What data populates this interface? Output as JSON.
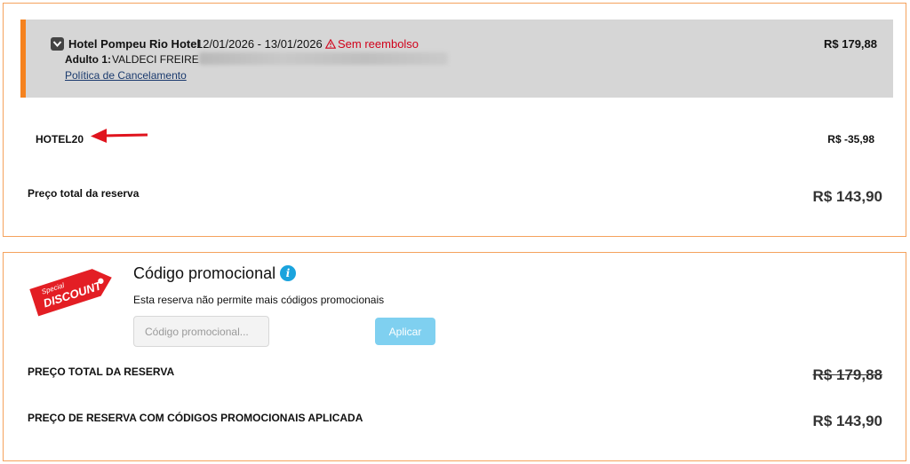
{
  "booking": {
    "hotel_name": "Hotel Pompeu Rio Hotel",
    "dates": "12/01/2026 - 13/01/2026",
    "non_refundable": "Sem reembolso",
    "price": "R$ 179,88",
    "guest_label": "Adulto 1:",
    "guest_name": "VALDECI FREIRE",
    "cancellation_link": "Política de Cancelamento"
  },
  "coupon": {
    "code": "HOTEL20",
    "amount": "R$ -35,98"
  },
  "total": {
    "label": "Preço total da reserva",
    "value": "R$ 143,90"
  },
  "promo": {
    "badge_top": "Special",
    "badge_main": "DISCOUNT",
    "title": "Código promocional",
    "info_glyph": "i",
    "note": "Esta reserva não permite mais códigos promocionais",
    "input_placeholder": "Código promocional...",
    "apply_label": "Aplicar",
    "total_label": "PREÇO TOTAL DA RESERVA",
    "total_value": "R$ 179,88",
    "final_label": "PREÇO DE RESERVA COM CÓDIGOS PROMOCIONAIS APLICADA",
    "final_value": "R$ 143,90"
  },
  "colors": {
    "panel_border": "#f5a25d",
    "accent_orange": "#f5821f",
    "nonref_red": "#d0021b",
    "arrow_red": "#e0141e",
    "info_blue": "#1aa3dd",
    "apply_button": "#7fd0f0",
    "badge_red": "#e31e24"
  },
  "icons": [
    "chevron-down-icon",
    "warning-icon",
    "red-arrow-icon",
    "discount-tag-icon",
    "info-icon"
  ]
}
